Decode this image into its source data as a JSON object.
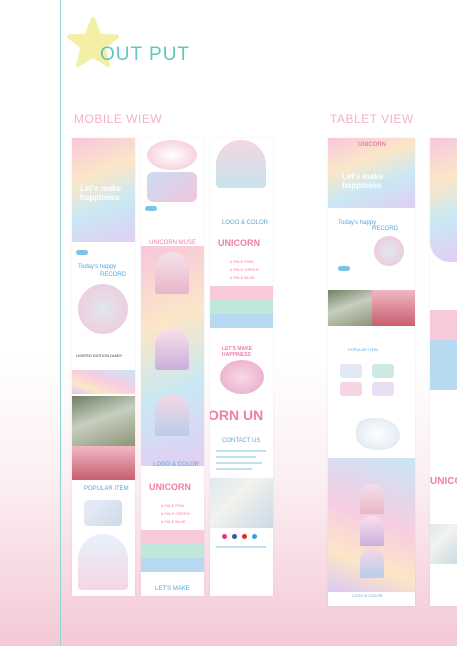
{
  "header": {
    "title": "OUT PUT"
  },
  "sections": {
    "mobile": "MOBILE WIEW",
    "tablet": "TABLET VIEW"
  },
  "mobile": {
    "hero_title": "Let's make\nhappiness",
    "todays_happy": "Today's happy",
    "record": "RECORD",
    "limited": "LIMITED EDITION DIARY",
    "popular": "POPULAR ITEM",
    "unicorn_muse": "UNICORN MUSE",
    "logo_color": "LOGO & COLOR",
    "unicorn_logo": "UNICORN",
    "color_names": [
      "# PALE PINK",
      "# PALE GREEN",
      "# PALE BLUE"
    ],
    "lets_make": "LET'S MAKE",
    "lets_make_happiness": "LET'S MAKE\nHAPPINESS",
    "banner": "ORN UN",
    "contact": "CONTACT US"
  },
  "tablet": {
    "brand": "UNICORN",
    "hero_title": "Let's make\nhappiness",
    "todays_happy": "Today's happy",
    "record": "RECORD",
    "popular": "POPULAR ITEM",
    "logo_color": "LOGO & COLOR"
  },
  "colors": {
    "accent": "#5ec7c0",
    "pink": "#ef7fa8",
    "blue": "#5aa7d8",
    "star": "#f3f0a6"
  }
}
